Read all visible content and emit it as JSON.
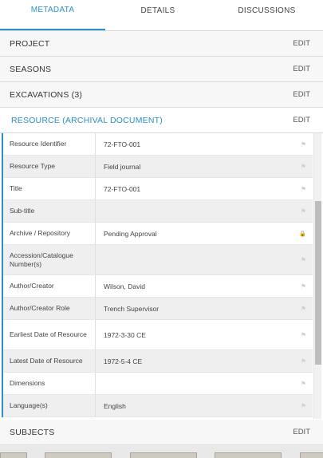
{
  "tabs": [
    {
      "label": "METADATA"
    },
    {
      "label": "DETAILS"
    },
    {
      "label": "DISCUSSIONS"
    }
  ],
  "sections": {
    "project": {
      "label": "PROJECT",
      "edit": "EDIT"
    },
    "seasons": {
      "label": "SEASONS",
      "edit": "EDIT"
    },
    "excavations": {
      "label": "EXCAVATIONS (3)",
      "edit": "EDIT"
    },
    "resource": {
      "label": "RESOURCE (ARCHIVAL DOCUMENT)",
      "edit": "EDIT"
    },
    "subjects": {
      "label": "SUBJECTS",
      "edit": "EDIT"
    }
  },
  "resource_fields": [
    {
      "key": "Resource Identifier",
      "value": "72-FTO-001",
      "icon": "flag-icon"
    },
    {
      "key": "Resource Type",
      "value": "Field journal",
      "icon": "flag-icon"
    },
    {
      "key": "Title",
      "value": "72-FTO-001",
      "icon": "flag-icon"
    },
    {
      "key": "Sub-title",
      "value": "",
      "icon": "flag-icon"
    },
    {
      "key": "Archive / Repository",
      "value": "Pending Approval",
      "icon": "lock-icon"
    },
    {
      "key": "Accession/Catalogue Number(s)",
      "value": "",
      "icon": "flag-icon"
    },
    {
      "key": "Author/Creator",
      "value": "Wilson, David",
      "icon": "flag-icon"
    },
    {
      "key": "Author/Creator Role",
      "value": "Trench Supervisor",
      "icon": "flag-icon"
    },
    {
      "key": "Earliest Date of Resource",
      "value": "1972-3-30 CE",
      "icon": "flag-icon"
    },
    {
      "key": "Latest Date of Resource",
      "value": "1972-5-4 CE",
      "icon": "flag-icon"
    },
    {
      "key": "Dimensions",
      "value": "",
      "icon": "flag-icon"
    },
    {
      "key": "Language(s)",
      "value": "English",
      "icon": "flag-icon"
    }
  ]
}
